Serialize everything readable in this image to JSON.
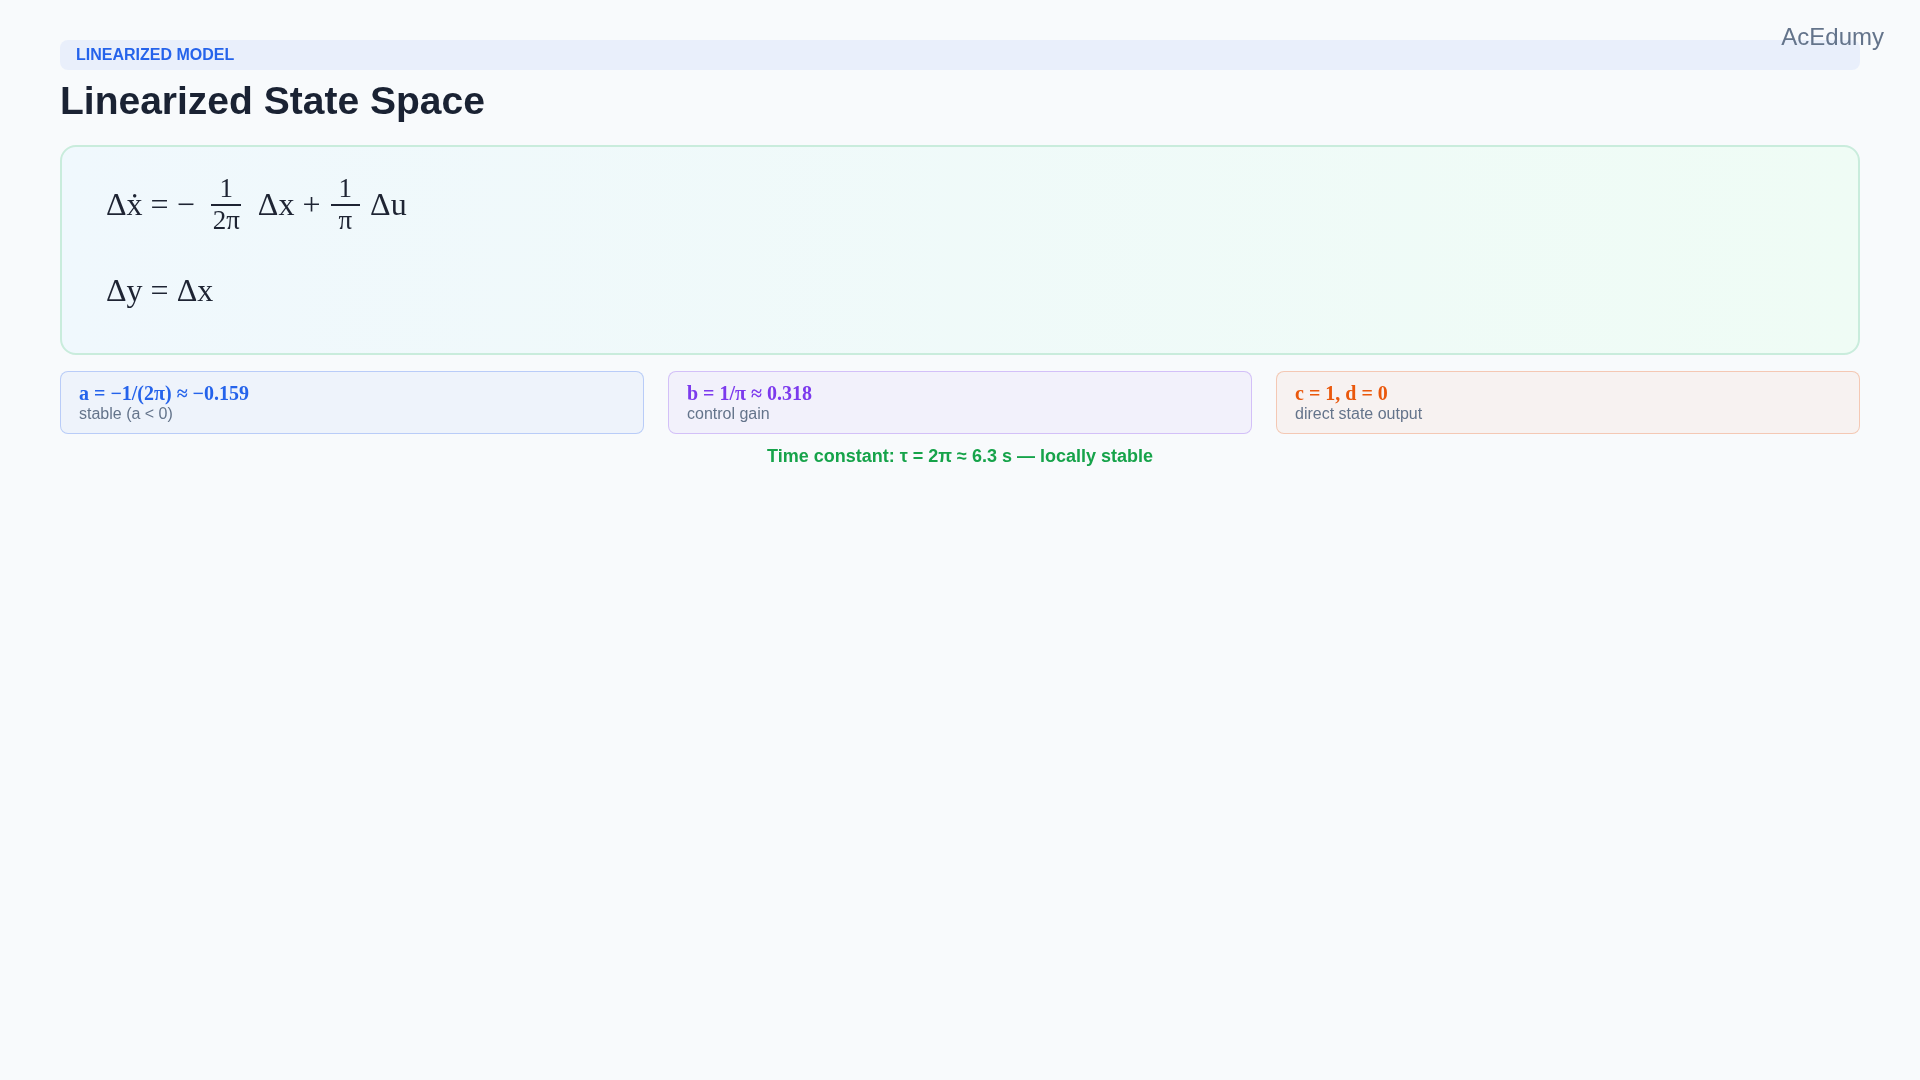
{
  "brand": "AcEdumy",
  "badge": "LINEARIZED MODEL",
  "title": "Linearized State Space",
  "equations": [
    {
      "parts": [
        {
          "kind": "text",
          "text": "Δẋ = −"
        },
        {
          "kind": "fraction",
          "numerator": "1",
          "denominator": "2π"
        },
        {
          "kind": "text",
          "text": "Δx +"
        },
        {
          "kind": "fraction",
          "numerator": "1",
          "denominator": "π"
        },
        {
          "kind": "text",
          "text": "Δu"
        }
      ]
    },
    {
      "parts": [
        {
          "kind": "text",
          "text": "Δy = Δx"
        }
      ]
    }
  ],
  "cards": [
    {
      "formula": "a = −1/(2π) ≈ −0.159",
      "caption": "stable (a < 0)",
      "color": "#2563eb"
    },
    {
      "formula": "b = 1/π ≈ 0.318",
      "caption": "control gain",
      "color": "#7c3aed"
    },
    {
      "formula": "c = 1, d = 0",
      "caption": "direct state output",
      "color": "#ea580c"
    }
  ],
  "footer": "Time constant: τ = 2π ≈ 6.3 s — locally stable"
}
